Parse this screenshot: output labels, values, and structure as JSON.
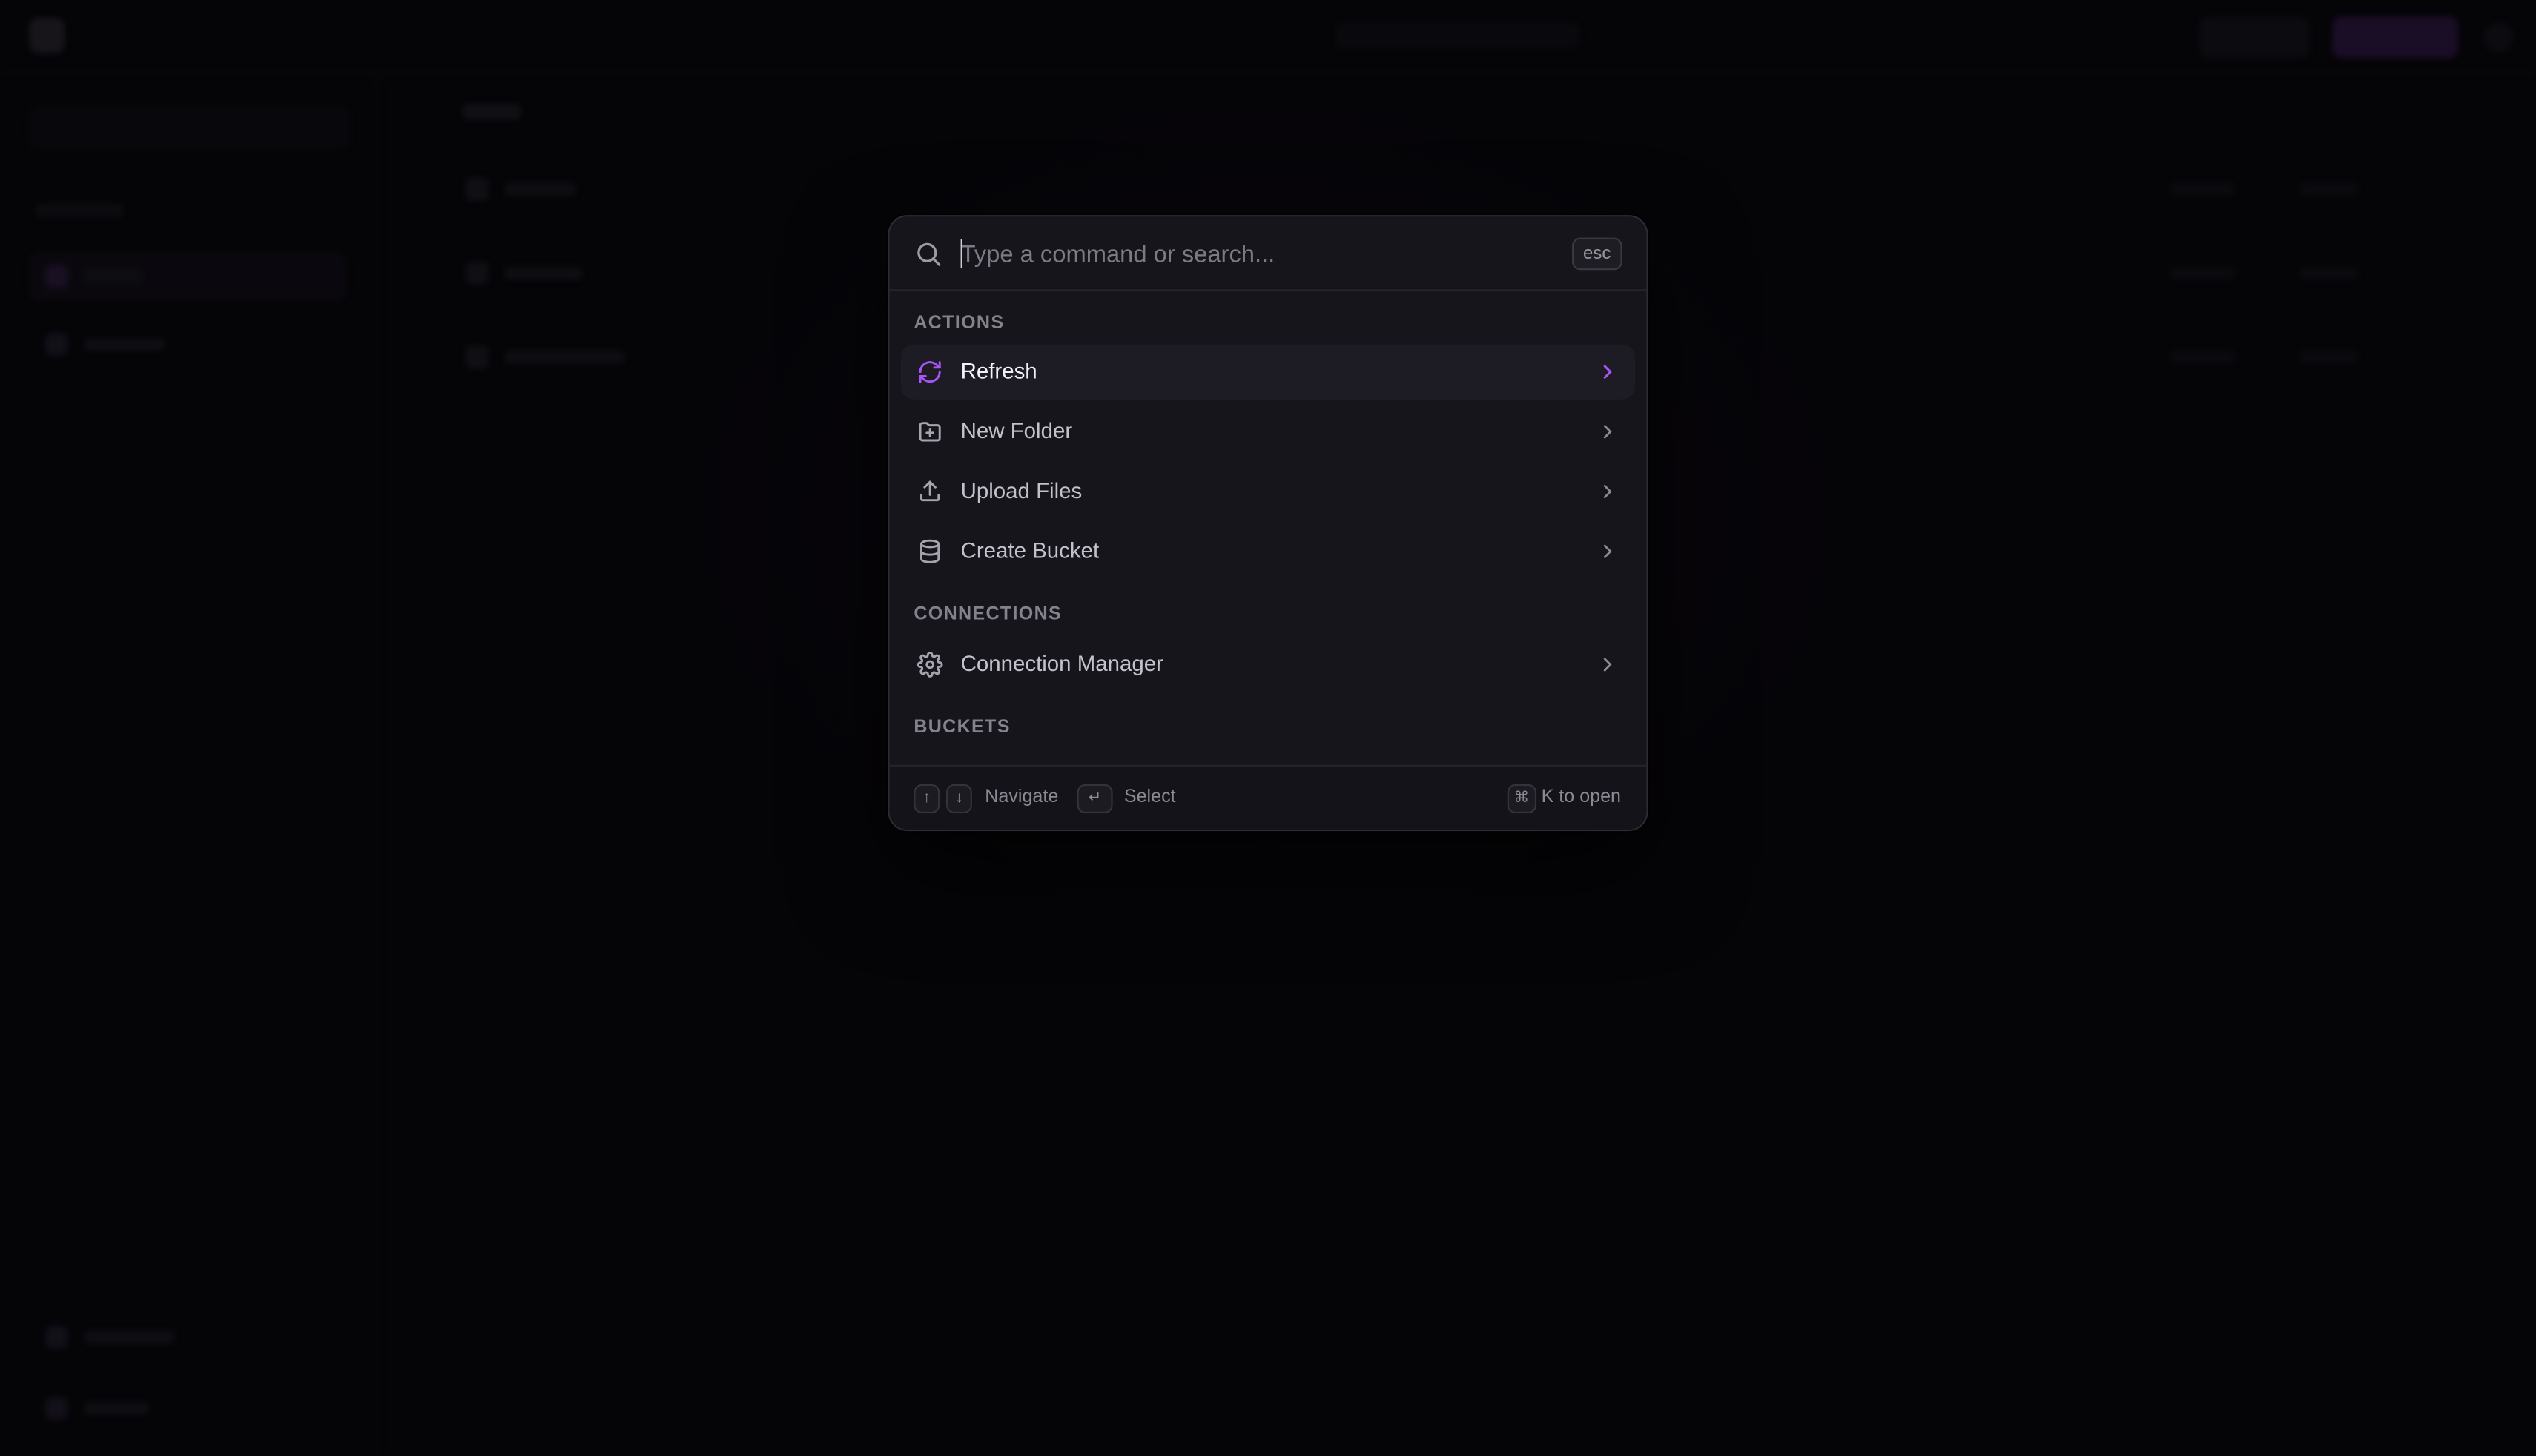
{
  "palette": {
    "search_placeholder": "Type a command or search...",
    "search_value": "",
    "esc_label": "esc",
    "accent_color": "#a855f7",
    "groups": {
      "actions": {
        "label": "ACTIONS",
        "items": [
          {
            "label": "Refresh",
            "icon": "refresh-icon",
            "active": true
          },
          {
            "label": "New Folder",
            "icon": "folder-plus-icon",
            "active": false
          },
          {
            "label": "Upload Files",
            "icon": "upload-icon",
            "active": false
          },
          {
            "label": "Create Bucket",
            "icon": "database-icon",
            "active": false
          }
        ]
      },
      "connections": {
        "label": "CONNECTIONS",
        "items": [
          {
            "label": "Connection Manager",
            "icon": "gear-icon",
            "active": false
          }
        ]
      },
      "buckets": {
        "label": "BUCKETS",
        "items": []
      }
    },
    "footer": {
      "up_key": "↑",
      "down_key": "↓",
      "navigate_label": "Navigate",
      "enter_key": "↵",
      "select_label": "Select",
      "cmd_key": "⌘",
      "open_label": "K to open"
    }
  }
}
